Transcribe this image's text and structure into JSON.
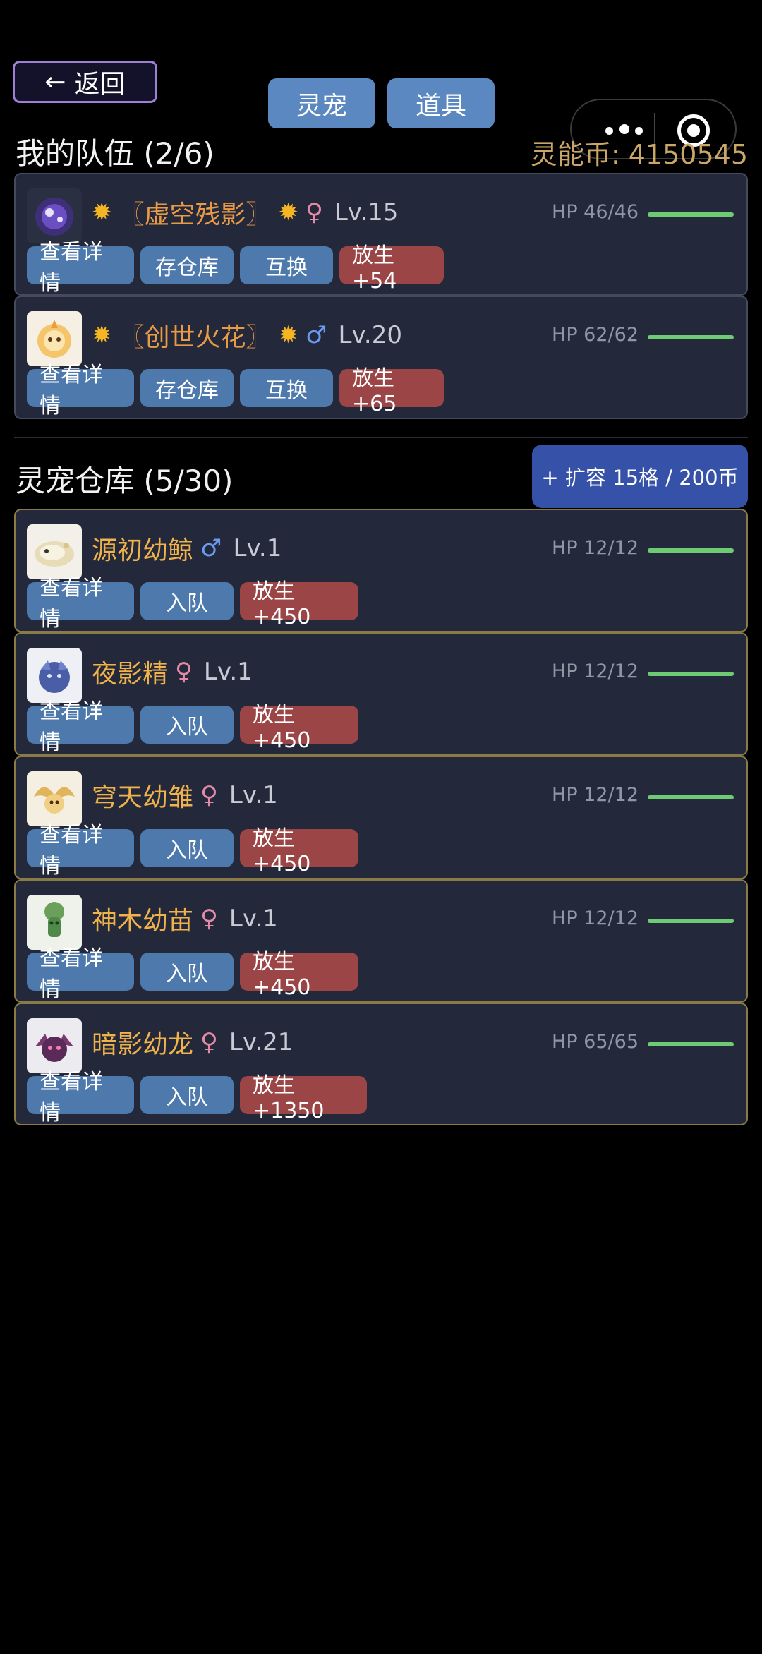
{
  "header": {
    "back_label": "返回",
    "tabs": [
      "灵宠",
      "道具"
    ]
  },
  "team": {
    "title": "我的队伍 (2/6)",
    "coins_label": "灵能币: 4150545",
    "pets": [
      {
        "name": "〖虚空残影〗",
        "gender": "♀",
        "level": "Lv.15",
        "hp": "HP 46/46",
        "hp_fraction": 1.0,
        "buttons": [
          "查看详情",
          "存仓库",
          "互换",
          "放生+54"
        ]
      },
      {
        "name": "〖创世火花〗",
        "gender": "♂",
        "level": "Lv.20",
        "hp": "HP 62/62",
        "hp_fraction": 1.0,
        "buttons": [
          "查看详情",
          "存仓库",
          "互换",
          "放生+65"
        ]
      }
    ]
  },
  "storage": {
    "title": "灵宠仓库 (5/30)",
    "expand_label": "+ 扩容 15格 / 200币",
    "pets": [
      {
        "name": "源初幼鲸",
        "gender": "♂",
        "level": "Lv.1",
        "hp": "HP 12/12",
        "hp_fraction": 1.0,
        "buttons": [
          "查看详情",
          "入队",
          "放生+450"
        ]
      },
      {
        "name": "夜影精",
        "gender": "♀",
        "level": "Lv.1",
        "hp": "HP 12/12",
        "hp_fraction": 1.0,
        "buttons": [
          "查看详情",
          "入队",
          "放生+450"
        ]
      },
      {
        "name": "穹天幼雏",
        "gender": "♀",
        "level": "Lv.1",
        "hp": "HP 12/12",
        "hp_fraction": 1.0,
        "buttons": [
          "查看详情",
          "入队",
          "放生+450"
        ]
      },
      {
        "name": "神木幼苗",
        "gender": "♀",
        "level": "Lv.1",
        "hp": "HP 12/12",
        "hp_fraction": 1.0,
        "buttons": [
          "查看详情",
          "入队",
          "放生+450"
        ]
      },
      {
        "name": "暗影幼龙",
        "gender": "♀",
        "level": "Lv.21",
        "hp": "HP 65/65",
        "hp_fraction": 1.0,
        "buttons": [
          "查看详情",
          "入队",
          "放生+1350"
        ]
      }
    ]
  },
  "colors": {
    "accent_blue": "#4d79ad",
    "release_red": "#9b4546",
    "hp_green": "#6ecb74",
    "name_gold": "#f0b24a",
    "coins_gold": "#caa668"
  }
}
